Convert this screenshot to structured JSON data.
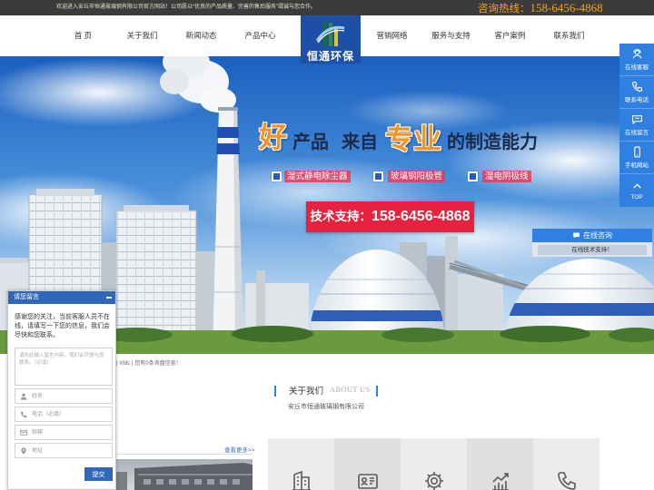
{
  "colors": {
    "topbar_bg": "#3b3b3b",
    "hotline": "#f5a31e",
    "primary_blue": "#2f80e0",
    "logo_blue": "#1d4fa6",
    "tech_red": "#e6223e",
    "accent_orange": "#f6931e",
    "chat_blue": "#2e68b8"
  },
  "topbar": {
    "welcome": "欢迎进入安丘市恒通玻璃钢有限公司官方网站！公司愿以“优良的产品质量、完善的售后服务”竭诚与您合作。",
    "hotline_label": "咨询热线：",
    "hotline_number": "158-6456-4868"
  },
  "nav": {
    "logo_text": "恒通环保",
    "left_items": [
      "首 页",
      "关于我们",
      "新闻动态",
      "产品中心"
    ],
    "right_items": [
      "营销网络",
      "服务与支持",
      "客户案例",
      "联系我们"
    ]
  },
  "banner": {
    "headline": {
      "big1": "好",
      "part1": "产品",
      "part2": "来自",
      "big2": "专业",
      "part3": "的制造能力"
    },
    "features": [
      "湿式静电除尘器",
      "玻璃钢阳极管",
      "湿电阴极线"
    ],
    "tech_label": "技术支持：",
    "tech_number": "158-6456-4868"
  },
  "sidebar": {
    "items": [
      {
        "label": "在线客服",
        "icon": "headset-icon"
      },
      {
        "label": "联系电话",
        "icon": "phone-icon"
      },
      {
        "label": "在线留言",
        "icon": "message-icon"
      },
      {
        "label": "手机网站",
        "icon": "mobile-icon"
      },
      {
        "label": "TOP",
        "icon": "arrow-up-icon"
      }
    ]
  },
  "consult": {
    "title": "在线咨询",
    "button": "在线技术支持！",
    "icon": "chat-icon"
  },
  "chat": {
    "title": "请您留言",
    "intro": "感谢您的关注，当前客服人员不在线，请填写一下您的信息，我们会尽快和您联系。",
    "message_placeholder": "请在此输入留言内容，我们会尽快与您联系。（必填）",
    "name_placeholder": "姓名",
    "phone_placeholder": "电话（必填）",
    "email_placeholder": "邮箱",
    "address_placeholder": "地址",
    "submit": "提交"
  },
  "strip": {
    "text": "| XML | 您有0条询盘信息！"
  },
  "about": {
    "title": "关于我们",
    "title_en": "ABOUT US",
    "company": "安丘市恒通玻璃钢有限公司"
  },
  "more_link": "查看更多>>",
  "feature_icons": [
    "building-icon",
    "certificate-icon",
    "gear-icon",
    "chart-icon",
    "phone-icon"
  ]
}
